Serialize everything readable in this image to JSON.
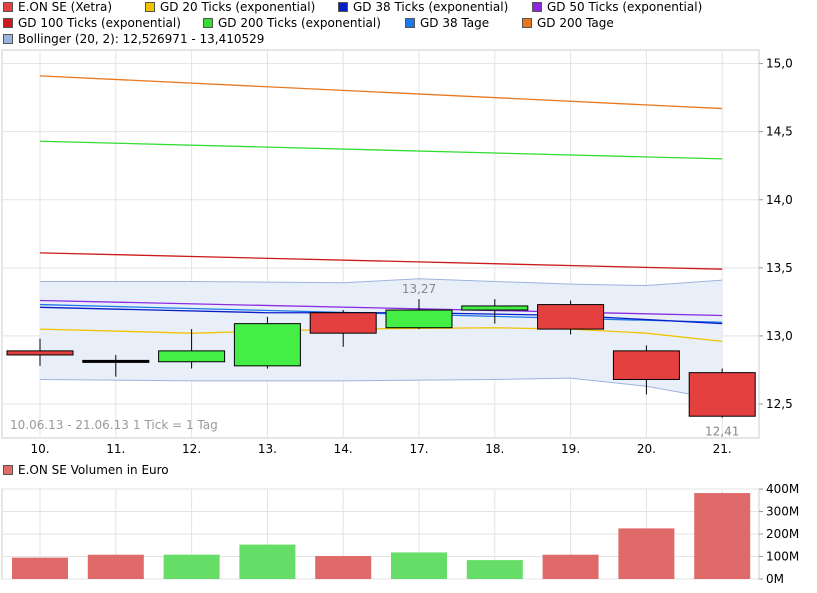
{
  "legend": [
    {
      "label": "E.ON SE (Xetra)",
      "color": "#e44040"
    },
    {
      "label": "GD 20 Ticks (exponential)",
      "color": "#f2c200"
    },
    {
      "label": "GD 38 Ticks (exponential)",
      "color": "#0a1ec8"
    },
    {
      "label": "GD 50 Ticks (exponential)",
      "color": "#8a2be2"
    },
    {
      "label": "GD 100 Ticks (exponential)",
      "color": "#cc1a1a"
    },
    {
      "label": "GD 200 Ticks (exponential)",
      "color": "#33dd33"
    },
    {
      "label": "GD 38 Tage",
      "color": "#1e78e6"
    },
    {
      "label": "GD 200 Tage",
      "color": "#e87820"
    },
    {
      "label": "Bollinger (20, 2): 12,526971 - 13,410529",
      "color": "#9db3dd"
    }
  ],
  "chart_data": [
    {
      "type": "candlestick",
      "categories": [
        "10.",
        "11.",
        "12.",
        "13.",
        "14.",
        "17.",
        "18.",
        "19.",
        "20.",
        "21."
      ],
      "ohlc": [
        [
          12.86,
          12.98,
          12.78,
          12.89
        ],
        [
          12.82,
          12.86,
          12.7,
          12.82
        ],
        [
          12.81,
          13.05,
          12.76,
          12.89
        ],
        [
          12.78,
          13.14,
          12.76,
          13.09
        ],
        [
          13.17,
          13.19,
          12.92,
          13.02
        ],
        [
          13.06,
          13.27,
          13.05,
          13.19
        ],
        [
          13.19,
          13.27,
          13.09,
          13.22
        ],
        [
          13.23,
          13.26,
          13.01,
          13.05
        ],
        [
          12.89,
          12.93,
          12.57,
          12.68
        ],
        [
          12.73,
          12.76,
          12.4,
          12.41
        ]
      ],
      "colors": [
        "#e44040",
        "#000000",
        "#44ee44",
        "#44ee44",
        "#e44040",
        "#44ee44",
        "#44ee44",
        "#e44040",
        "#e44040",
        "#e44040"
      ],
      "annotations": {
        "high_label": "13,27",
        "low_label": "12,41"
      },
      "range_text": "10.06.13 - 21.06.13",
      "tick_text": "1 Tick = 1 Tag",
      "ylim": [
        12.25,
        15.1
      ],
      "yticks": [
        12.5,
        13.0,
        13.5,
        14.0,
        14.5,
        15.0
      ],
      "ytick_labels": [
        "12,5",
        "13,0",
        "13,5",
        "14,0",
        "14,5",
        "15,0"
      ],
      "grid": true,
      "series": [
        {
          "name": "GD 200 Tage",
          "color": "#e87820",
          "x": [
            0,
            9
          ],
          "values": [
            14.91,
            14.67
          ]
        },
        {
          "name": "GD 200 Ticks (exponential)",
          "color": "#33dd33",
          "x": [
            0,
            9
          ],
          "values": [
            14.43,
            14.3
          ]
        },
        {
          "name": "GD 100 Ticks (exponential)",
          "color": "#cc1a1a",
          "x": [
            0,
            9
          ],
          "values": [
            13.61,
            13.49
          ]
        },
        {
          "name": "GD 50 Ticks (exponential)",
          "color": "#8a2be2",
          "x": [
            0,
            9
          ],
          "values": [
            13.26,
            13.15
          ]
        },
        {
          "name": "GD 38 Tage",
          "color": "#1e78e6",
          "x": [
            0,
            9
          ],
          "values": [
            13.23,
            13.1
          ]
        },
        {
          "name": "GD 38 Ticks (exponential)",
          "color": "#0a1ec8",
          "x": [
            0,
            3,
            5,
            7,
            9
          ],
          "values": [
            13.21,
            13.17,
            13.17,
            13.15,
            13.09
          ]
        },
        {
          "name": "GD 20 Ticks (exponential)",
          "color": "#f2c200",
          "x": [
            0,
            2,
            4,
            6,
            7,
            8,
            9
          ],
          "values": [
            13.05,
            13.02,
            13.05,
            13.06,
            13.05,
            13.02,
            12.96
          ]
        }
      ],
      "bollinger": {
        "color": "#9db3dd",
        "upper_x": [
          0,
          2,
          4,
          5,
          6,
          7,
          8,
          9
        ],
        "upper": [
          13.4,
          13.4,
          13.39,
          13.42,
          13.4,
          13.38,
          13.37,
          13.41
        ],
        "lower_x": [
          0,
          2,
          4,
          6,
          7,
          8,
          9
        ],
        "lower": [
          12.68,
          12.67,
          12.67,
          12.68,
          12.69,
          12.63,
          12.53
        ]
      }
    },
    {
      "type": "bar",
      "title": "E.ON SE Volumen in Euro",
      "title_color": "#e46a6a",
      "categories": [
        "10.",
        "11.",
        "12.",
        "13.",
        "14.",
        "17.",
        "18.",
        "19.",
        "20.",
        "21."
      ],
      "values": [
        95,
        108,
        108,
        153,
        102,
        118,
        84,
        108,
        225,
        382
      ],
      "unit": "M",
      "colors": [
        "#e06a6a",
        "#e06a6a",
        "#66dd66",
        "#66dd66",
        "#e06a6a",
        "#66dd66",
        "#66dd66",
        "#e06a6a",
        "#e06a6a",
        "#e06a6a"
      ],
      "ylim": [
        0,
        400
      ],
      "yticks": [
        0,
        100,
        200,
        300,
        400
      ],
      "ytick_labels": [
        "0M",
        "100M",
        "200M",
        "300M",
        "400M"
      ],
      "grid": true
    }
  ]
}
